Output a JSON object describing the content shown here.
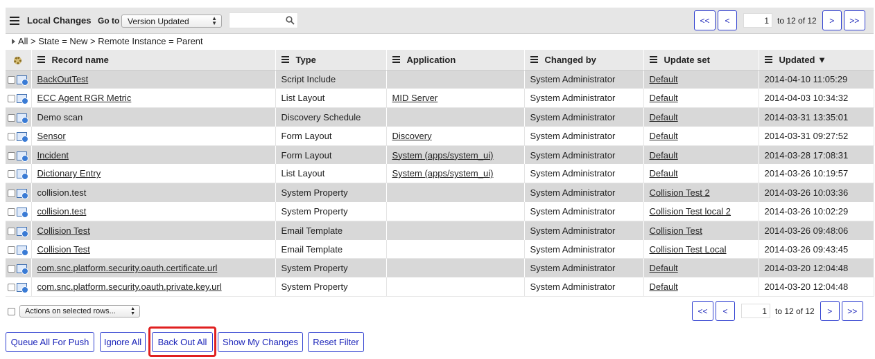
{
  "header": {
    "title": "Local Changes",
    "goto_label": "Go to",
    "goto_value": "Version Updated",
    "search_value": ""
  },
  "pager_top": {
    "first": "<<",
    "prev": "<",
    "page": "1",
    "range": "to 12 of 12",
    "next": ">",
    "last": ">>"
  },
  "pager_bottom": {
    "first": "<<",
    "prev": "<",
    "page": "1",
    "range": "to 12 of 12",
    "next": ">",
    "last": ">>"
  },
  "breadcrumb": "All > State = New > Remote Instance = Parent",
  "columns": [
    "Record name",
    "Type",
    "Application",
    "Changed by",
    "Update set",
    "Updated ▼"
  ],
  "rows": [
    {
      "name": "BackOutTest",
      "name_link": true,
      "type": "Script Include",
      "app": "",
      "changed_by": "System Administrator",
      "update_set": "Default",
      "updated": "2014-04-10 11:05:29"
    },
    {
      "name": "ECC Agent RGR Metric",
      "name_link": true,
      "type": "List Layout",
      "app": "MID Server",
      "changed_by": "System Administrator",
      "update_set": "Default",
      "updated": "2014-04-03 10:34:32"
    },
    {
      "name": "Demo scan",
      "name_link": false,
      "type": "Discovery Schedule",
      "app": "",
      "changed_by": "System Administrator",
      "update_set": "Default",
      "updated": "2014-03-31 13:35:01"
    },
    {
      "name": "Sensor",
      "name_link": true,
      "type": "Form Layout",
      "app": "Discovery",
      "changed_by": "System Administrator",
      "update_set": "Default",
      "updated": "2014-03-31 09:27:52"
    },
    {
      "name": "Incident",
      "name_link": true,
      "type": "Form Layout",
      "app": "System (apps/system_ui)",
      "changed_by": "System Administrator",
      "update_set": "Default",
      "updated": "2014-03-28 17:08:31"
    },
    {
      "name": "Dictionary Entry",
      "name_link": true,
      "type": "List Layout",
      "app": "System (apps/system_ui)",
      "changed_by": "System Administrator",
      "update_set": "Default",
      "updated": "2014-03-26 10:19:57"
    },
    {
      "name": "collision.test",
      "name_link": false,
      "type": "System Property",
      "app": "",
      "changed_by": "System Administrator",
      "update_set": "Collision Test 2",
      "updated": "2014-03-26 10:03:36"
    },
    {
      "name": "collision.test",
      "name_link": true,
      "type": "System Property",
      "app": "",
      "changed_by": "System Administrator",
      "update_set": "Collision Test local 2",
      "updated": "2014-03-26 10:02:29"
    },
    {
      "name": "Collision Test",
      "name_link": true,
      "type": "Email Template",
      "app": "",
      "changed_by": "System Administrator",
      "update_set": "Collision Test",
      "updated": "2014-03-26 09:48:06"
    },
    {
      "name": "Collision Test",
      "name_link": true,
      "type": "Email Template",
      "app": "",
      "changed_by": "System Administrator",
      "update_set": "Collision Test Local",
      "updated": "2014-03-26 09:43:45"
    },
    {
      "name": "com.snc.platform.security.oauth.certificate.url",
      "name_link": true,
      "type": "System Property",
      "app": "",
      "changed_by": "System Administrator",
      "update_set": "Default",
      "updated": "2014-03-20 12:04:48"
    },
    {
      "name": "com.snc.platform.security.oauth.private.key.url",
      "name_link": true,
      "type": "System Property",
      "app": "",
      "changed_by": "System Administrator",
      "update_set": "Default",
      "updated": "2014-03-20 12:04:48"
    }
  ],
  "actions_select": "Actions on selected rows...",
  "buttons": {
    "queue_all": "Queue All For Push",
    "ignore_all": "Ignore All",
    "back_out_all": "Back Out All",
    "show_my_changes": "Show My Changes",
    "reset_filter": "Reset Filter"
  },
  "colors": {
    "accent": "#1a23b8",
    "highlight": "#e02020",
    "row_shade": "#d8d8d8"
  }
}
